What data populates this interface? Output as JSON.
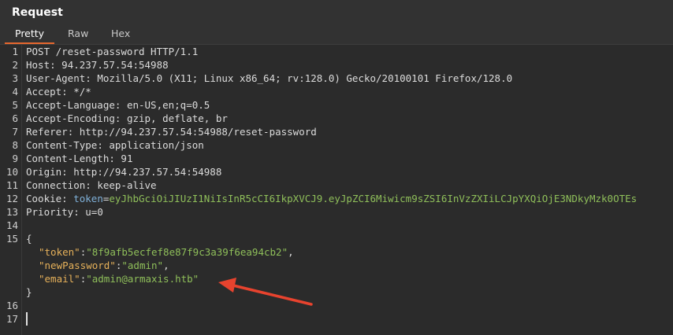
{
  "panel": {
    "title": "Request"
  },
  "tabs": [
    {
      "label": "Pretty",
      "active": true
    },
    {
      "label": "Raw",
      "active": false
    },
    {
      "label": "Hex",
      "active": false
    }
  ],
  "request": {
    "line1": "POST /reset-password HTTP/1.1",
    "headers": [
      {
        "name": "Host",
        "value": "94.237.57.54:54988"
      },
      {
        "name": "User-Agent",
        "value": "Mozilla/5.0 (X11; Linux x86_64; rv:128.0) Gecko/20100101 Firefox/128.0"
      },
      {
        "name": "Accept",
        "value": "*/*"
      },
      {
        "name": "Accept-Language",
        "value": "en-US,en;q=0.5"
      },
      {
        "name": "Accept-Encoding",
        "value": "gzip, deflate, br"
      },
      {
        "name": "Referer",
        "value": "http://94.237.57.54:54988/reset-password"
      },
      {
        "name": "Content-Type",
        "value": "application/json"
      },
      {
        "name": "Content-Length",
        "value": "91"
      },
      {
        "name": "Origin",
        "value": "http://94.237.57.54:54988"
      },
      {
        "name": "Connection",
        "value": "keep-alive"
      }
    ],
    "cookie": {
      "name": "Cookie",
      "cookie_name": "token",
      "cookie_value": "eyJhbGciOiJIUzI1NiIsInR5cCI6IkpXVCJ9.eyJpZCI6Miwicm9sZSI6InVzZXIiLCJpYXQiOjE3NDkyMzk0OTEs"
    },
    "priority": {
      "name": "Priority",
      "value": "u=0"
    },
    "body": {
      "open": "{",
      "close": "}",
      "fields": [
        {
          "key": "\"token\"",
          "value": "\"8f9afb5ecfef8e87f9c3a39f6ea94cb2\"",
          "comma": ","
        },
        {
          "key": "\"newPassword\"",
          "value": "\"admin\"",
          "comma": ","
        },
        {
          "key": "\"email\"",
          "value": "\"admin@armaxis.htb\"",
          "comma": ""
        }
      ]
    }
  },
  "line_numbers": [
    "1",
    "2",
    "3",
    "4",
    "5",
    "6",
    "7",
    "8",
    "9",
    "10",
    "11",
    "12",
    "13",
    "14",
    "15",
    "16",
    "17"
  ],
  "colors": {
    "accent": "#e6672e",
    "arrow": "#e8432e"
  }
}
